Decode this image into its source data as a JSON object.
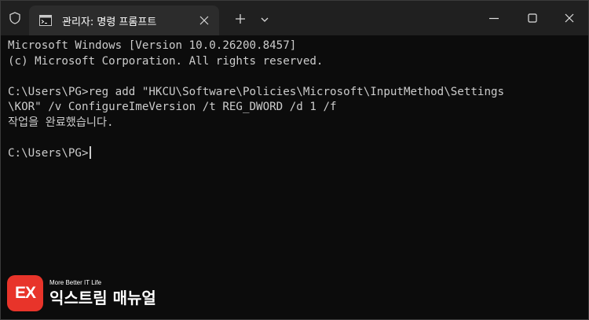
{
  "window": {
    "tab_title": "관리자: 명령 프롬프트",
    "icons": {
      "shield": "shield-icon",
      "terminal": "terminal-icon",
      "close_tab": "close-icon",
      "new_tab": "plus-icon",
      "dropdown": "chevron-down-icon",
      "minimize": "minimize-icon",
      "maximize": "maximize-icon",
      "close_window": "close-icon"
    }
  },
  "terminal": {
    "lines": [
      "Microsoft Windows [Version 10.0.26200.8457]",
      "(c) Microsoft Corporation. All rights reserved.",
      "",
      "C:\\Users\\PG>reg add \"HKCU\\Software\\Policies\\Microsoft\\InputMethod\\Settings",
      "\\KOR\" /v ConfigureImeVersion /t REG_DWORD /d 1 /f",
      "작업을 완료했습니다.",
      "",
      "C:\\Users\\PG>"
    ]
  },
  "watermark": {
    "logo_text": "EX",
    "tagline": "More Better IT Life",
    "brand": "익스트림 매뉴얼"
  },
  "colors": {
    "terminal_bg": "#0c0c0c",
    "titlebar_bg": "#202020",
    "tab_bg": "#2c2c2c",
    "text": "#cccccc",
    "logo": "#e8342a"
  }
}
